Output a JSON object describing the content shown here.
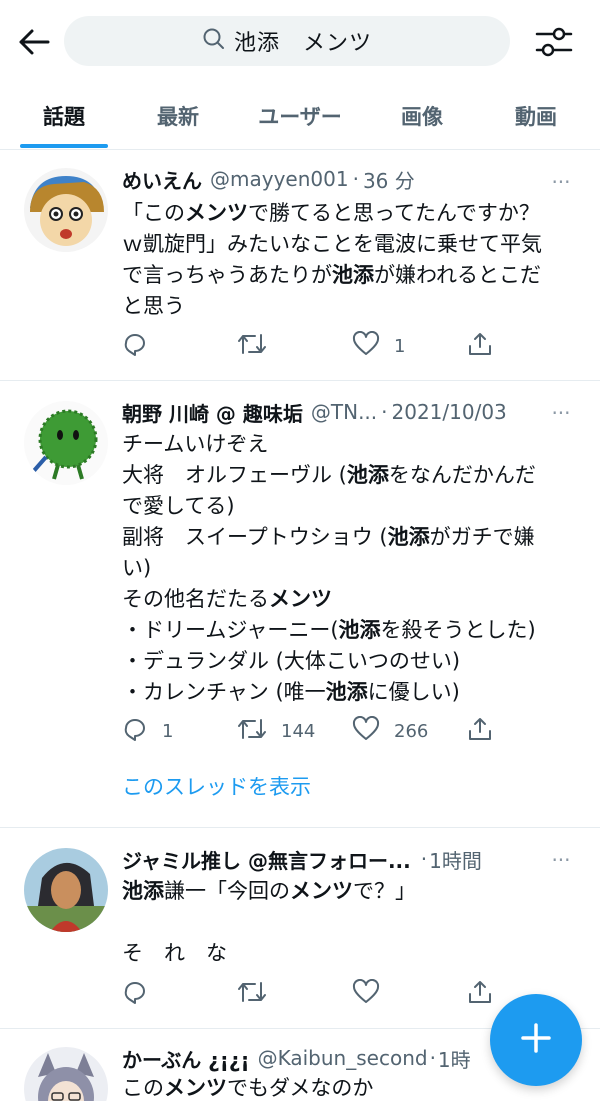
{
  "search": {
    "query": "池添　メンツ"
  },
  "tabs": [
    {
      "label": "話題",
      "active": true
    },
    {
      "label": "最新",
      "active": false
    },
    {
      "label": "ユーザー",
      "active": false
    },
    {
      "label": "画像",
      "active": false
    },
    {
      "label": "動画",
      "active": false
    }
  ],
  "tweets": [
    {
      "name": "めいえん",
      "handle": "@mayyen001",
      "sep": "·",
      "time": "36 分",
      "text_lines": [
        [
          "「この",
          "メンツ",
          "で勝てると思ってたんですか？"
        ],
        [
          "ｗ凱旋門」みたいなことを電波に乗せて平気"
        ],
        [
          "で言っちゃうあたりが",
          "池添",
          "が嫌われるとこだ"
        ],
        [
          "と思う"
        ]
      ],
      "reply_count": "",
      "retweet_count": "",
      "like_count": "1"
    },
    {
      "name": "朝野 川崎 @ 趣味垢",
      "handle": "@TN...",
      "sep": "·",
      "time": "2021/10/03",
      "text_lines": [
        [
          "チームいけぞえ"
        ],
        [
          "大将　オルフェーヴル (",
          "池添",
          "をなんだかんだ"
        ],
        [
          "で愛してる)"
        ],
        [
          "副将　スイープトウショウ (",
          "池添",
          "がガチで嫌"
        ],
        [
          "い)"
        ],
        [
          "その他名だたる",
          "メンツ",
          ""
        ],
        [
          "・ドリームジャーニー(",
          "池添",
          "を殺そうとした)"
        ],
        [
          "・デュランダル (大体こいつのせい)"
        ],
        [
          "・カレンチャン (唯一",
          "池添",
          "に優しい)"
        ]
      ],
      "reply_count": "1",
      "retweet_count": "144",
      "like_count": "266",
      "thread_link": "このスレッドを表示"
    },
    {
      "name": "ジャミル推し @無言フォロー...",
      "handle": "",
      "sep": "·",
      "time": "1時間",
      "text_lines": [
        [
          "",
          "池添",
          "謙一「今回の",
          "メンツ",
          "で？」"
        ],
        [
          ""
        ],
        [
          "そ　れ　な"
        ]
      ],
      "reply_count": "",
      "retweet_count": "",
      "like_count": ""
    },
    {
      "name": "かーぶん ¿¡¿¡",
      "handle": "@Kaibun_second",
      "sep": "·",
      "time": "1時",
      "text_lines": [
        [
          "この",
          "メンツ",
          "でもダメなのか"
        ]
      ]
    }
  ],
  "icons": {
    "back": "arrow-left-icon",
    "search": "search-icon",
    "filter": "sliders-icon",
    "reply": "reply-icon",
    "retweet": "retweet-icon",
    "like": "heart-icon",
    "share": "share-icon",
    "compose": "plus-icon"
  },
  "colors": {
    "accent": "#1d9bf0",
    "text": "#0f1419",
    "muted": "#536471"
  }
}
